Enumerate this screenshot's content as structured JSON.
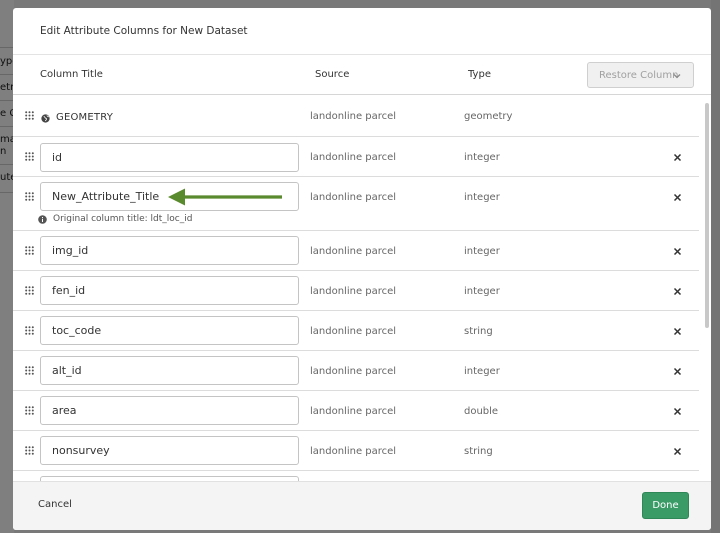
{
  "background": {
    "fragments": [
      "ype",
      "etry",
      "e C",
      "mat",
      "n",
      "ute"
    ]
  },
  "modal": {
    "title": "Edit Attribute Columns for New Dataset",
    "headers": {
      "column_title": "Column Title",
      "source": "Source",
      "type": "Type"
    },
    "restore_button": "Restore Column",
    "geometry_row": {
      "label": "GEOMETRY",
      "source": "landonline parcel",
      "type": "geometry",
      "icon": "globe-icon"
    },
    "rows": [
      {
        "value": "id",
        "source": "landonline parcel",
        "type": "integer"
      },
      {
        "value": "New_Attribute_Title",
        "source": "landonline parcel",
        "type": "integer",
        "hint": "Original column title: ldt_loc_id"
      },
      {
        "value": "img_id",
        "source": "landonline parcel",
        "type": "integer"
      },
      {
        "value": "fen_id",
        "source": "landonline parcel",
        "type": "integer"
      },
      {
        "value": "toc_code",
        "source": "landonline parcel",
        "type": "string"
      },
      {
        "value": "alt_id",
        "source": "landonline parcel",
        "type": "integer"
      },
      {
        "value": "area",
        "source": "landonline parcel",
        "type": "double"
      },
      {
        "value": "nonsurvey",
        "source": "landonline parcel",
        "type": "string"
      },
      {
        "value": "",
        "source": "",
        "type": ""
      }
    ],
    "footer": {
      "cancel": "Cancel",
      "done": "Done"
    }
  },
  "colors": {
    "accent_green": "#3a9b67",
    "arrow_green": "#5a8a2e",
    "overlay": "rgba(0,0,0,0.5)"
  }
}
